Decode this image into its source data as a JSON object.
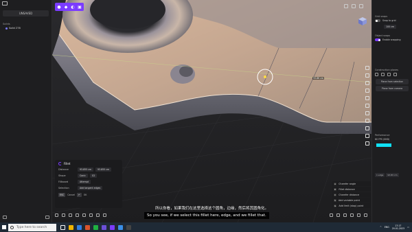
{
  "left_panel": {
    "title": "UNSAVED",
    "section": "Solids",
    "items": [
      {
        "label": "Solid 278"
      }
    ]
  },
  "right_panel": {
    "grid_label": "Grid snaps",
    "snap_to_grid": "Snap to grid",
    "grid_value": "100 cm",
    "object_snaps_label": "Object snaps",
    "enable_snapping": "Enable snapping",
    "construction_planes": "Construction planes",
    "plane_from_selection": "Plane from selection",
    "plane_from_camera": "Plane from camera",
    "performance": "Performance",
    "perf_value": "60 FPS (SHD)",
    "selection_count": "1 edge",
    "selection_value": "93.83 cm"
  },
  "fillet": {
    "title": "Fillet",
    "distance_label": "Distance",
    "distance_values": [
      "93.855 cm",
      "93.855 cm"
    ],
    "shape_label": "Shape",
    "shape_value": "Conic",
    "shape_param": "G2",
    "fillboard_label": "Fillboard",
    "fillboard_value": "Attempt",
    "selection_label": "Selection",
    "selection_value": "Add tangent edges",
    "esc_key": "ESC",
    "cancel": "Cancel",
    "enter_key": "↵",
    "ok": "OK"
  },
  "context_menu": [
    {
      "key": "A",
      "label": "Chamfer angle"
    },
    {
      "key": "D",
      "label": "Fillet distance"
    },
    {
      "key": "C",
      "label": "Chamfer distance"
    },
    {
      "key": "S",
      "label": "Add variable point"
    },
    {
      "key": "G",
      "label": "Add limit (stop) point"
    }
  ],
  "measure": "93.86 cm",
  "subtitles": {
    "chinese": "所以你看，如果我们在这里选择这个圆角，边缘，然后将其圆角化。",
    "english": "So you see, if we select this fillet here, edge, and we fillet that."
  },
  "taskbar": {
    "search_placeholder": "Type here to search",
    "lang": "ENG",
    "time": "17:17",
    "date": "20.01.2023"
  },
  "colors": {
    "accent": "#7b3cff",
    "performance_bar": "#10e0f4",
    "taskbar": "#1f2a36"
  }
}
